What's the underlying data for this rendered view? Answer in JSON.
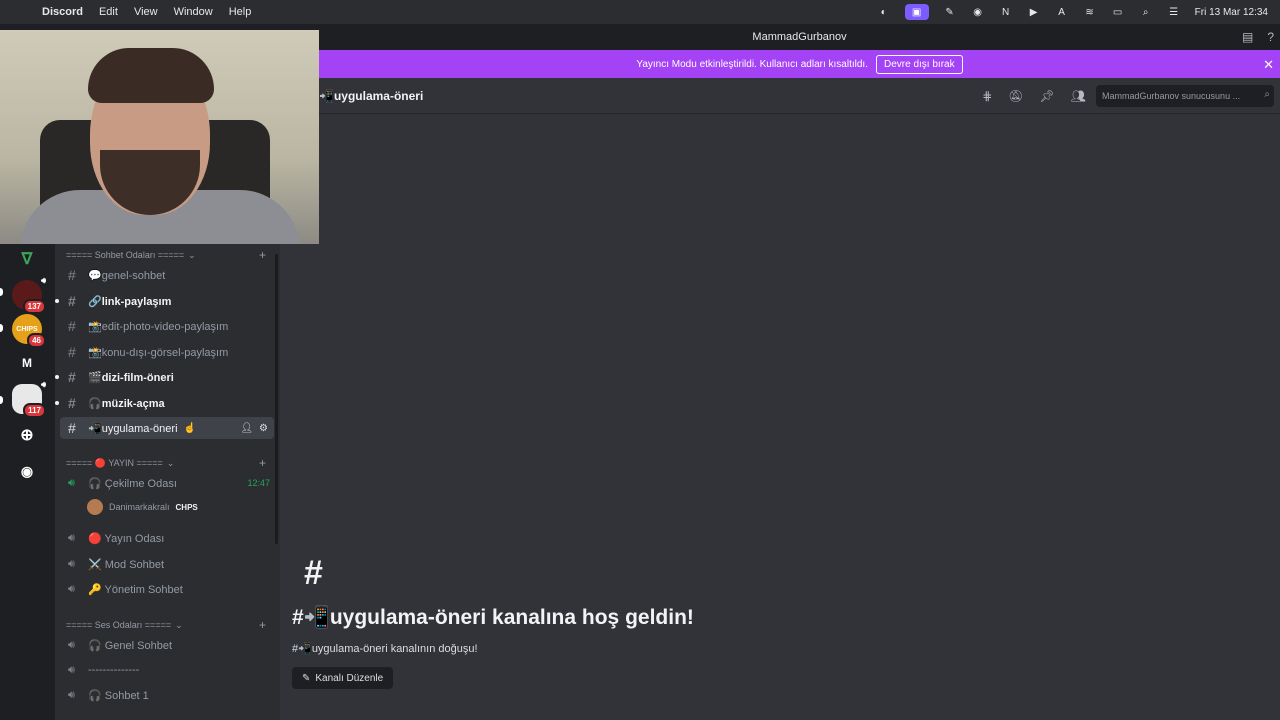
{
  "menubar": {
    "app": "Discord",
    "items": [
      "Edit",
      "View",
      "Window",
      "Help"
    ],
    "clock": "Fri 13 Mar  12:34"
  },
  "window": {
    "title": "MammadGurbanov"
  },
  "banner": {
    "text": "Yayıncı Modu etkinleştirildi. Kullanıcı adları kısaltıldı.",
    "button": "Devre dışı bırak"
  },
  "guilds": [
    {
      "name": "",
      "badge": ""
    },
    {
      "name": "",
      "badge": "137"
    },
    {
      "name": "CHIPS",
      "badge": "46"
    },
    {
      "name": "M",
      "badge": ""
    },
    {
      "name": "",
      "badge": "117"
    }
  ],
  "channels": {
    "categories": [
      "===== Sohbet Odaları =====",
      "===== 🔴 YAYIN =====",
      "===== Ses Odaları ====="
    ],
    "text": [
      {
        "label": "💬genel-sohbet"
      },
      {
        "label": "🔗link-paylaşım"
      },
      {
        "label": "📸edit-photo-video-paylaşım"
      },
      {
        "label": "📸konu-dışı-görsel-paylaşım"
      },
      {
        "label": "🎬dizi-film-öneri"
      },
      {
        "label": "🎧müzik-açma"
      },
      {
        "label": "📲uygulama-öneri"
      }
    ],
    "voice_stream": [
      {
        "label": "🎧 Çekilme Odası",
        "time": "12:47"
      },
      {
        "label": "🔴 Yayın Odası"
      },
      {
        "label": "⚔️ Mod Sohbet"
      },
      {
        "label": "🔑 Yönetim Sohbet"
      }
    ],
    "voice_user": {
      "name": "Danimarkakralı",
      "tag": "CHPS"
    },
    "voice_rooms": [
      {
        "label": "🎧 Genel Sohbet"
      },
      {
        "label": "--------------"
      },
      {
        "label": "🎧 Sohbet 1"
      }
    ]
  },
  "header": {
    "channel": "📲uygulama-öneri",
    "search_placeholder": "MammadGurbanov sunucusunu ..."
  },
  "welcome": {
    "hash": "#",
    "title": "#📲uygulama-öneri kanalına hoş geldin!",
    "subtitle": "#📲uygulama-öneri kanalının doğuşu!",
    "edit_button": "Kanalı Düzenle"
  }
}
